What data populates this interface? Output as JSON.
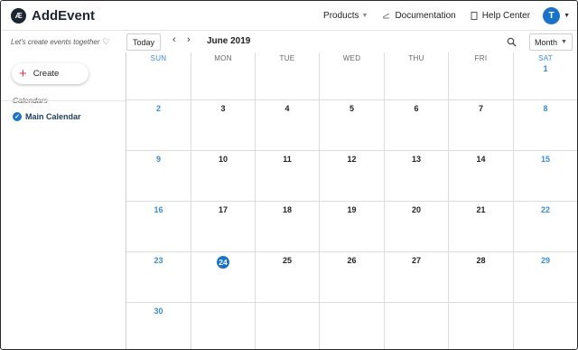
{
  "app": {
    "logo_mark": "Æ",
    "name": "AddEvent",
    "nav": {
      "products": "Products",
      "documentation": "Documentation",
      "help_center": "Help Center"
    },
    "user_initial": "T"
  },
  "toolbar": {
    "tagline": "Let's create events together",
    "today": "Today",
    "month_label": "June 2019",
    "view": "Month"
  },
  "sidebar": {
    "create": "Create",
    "calendars_heading": "Calendars",
    "calendars": [
      "Main Calendar"
    ]
  },
  "calendar": {
    "weekdays": [
      "SUN",
      "MON",
      "TUE",
      "WED",
      "THU",
      "FRI",
      "SAT"
    ],
    "weeks": [
      [
        "",
        "",
        "",
        "",
        "",
        "",
        "1"
      ],
      [
        "2",
        "3",
        "4",
        "5",
        "6",
        "7",
        "8"
      ],
      [
        "9",
        "10",
        "11",
        "12",
        "13",
        "14",
        "15"
      ],
      [
        "16",
        "17",
        "18",
        "19",
        "20",
        "21",
        "22"
      ],
      [
        "23",
        "24",
        "25",
        "26",
        "27",
        "28",
        "29"
      ],
      [
        "30",
        "",
        "",
        "",
        "",
        "",
        ""
      ]
    ],
    "today": "24"
  }
}
